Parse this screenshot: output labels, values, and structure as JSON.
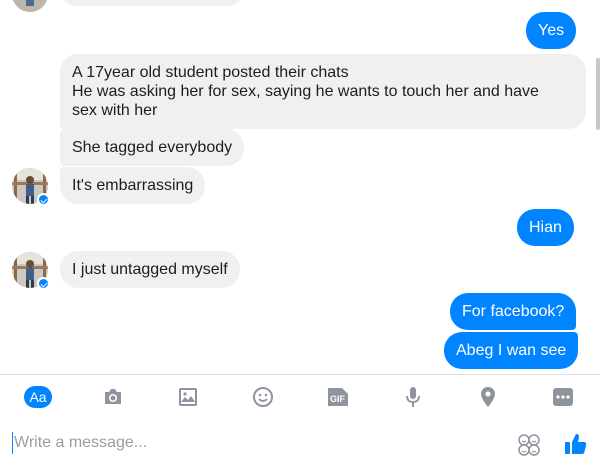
{
  "messages": [
    {
      "id": "m1",
      "side": "out",
      "text": "Yes"
    },
    {
      "id": "m2",
      "side": "in",
      "lines": [
        "A 17year old student posted their chats",
        "He was asking her for sex, saying he wants to touch her and have",
        "sex with her"
      ]
    },
    {
      "id": "m3",
      "side": "in",
      "text": "She tagged everybody"
    },
    {
      "id": "m4",
      "side": "in",
      "text": "It's embarrassing"
    },
    {
      "id": "m5",
      "side": "out",
      "text": "Hian"
    },
    {
      "id": "m6",
      "side": "in",
      "text": "I just untagged myself"
    },
    {
      "id": "m7",
      "side": "out",
      "text": "For facebook?"
    },
    {
      "id": "m8",
      "side": "out",
      "text": "Abeg I wan see"
    }
  ],
  "toolbar": {
    "aa_label": "Aa",
    "gif_label": "GIF",
    "icons": [
      "text-size-icon",
      "camera-icon",
      "image-icon",
      "emoji-icon",
      "gif-icon",
      "microphone-icon",
      "location-pin-icon",
      "more-icon"
    ]
  },
  "composer": {
    "placeholder": "Write a message...",
    "value": ""
  },
  "colors": {
    "accent": "#0084ff",
    "incoming_bubble": "#f1f0f0",
    "icon_gray": "#8d949e"
  }
}
